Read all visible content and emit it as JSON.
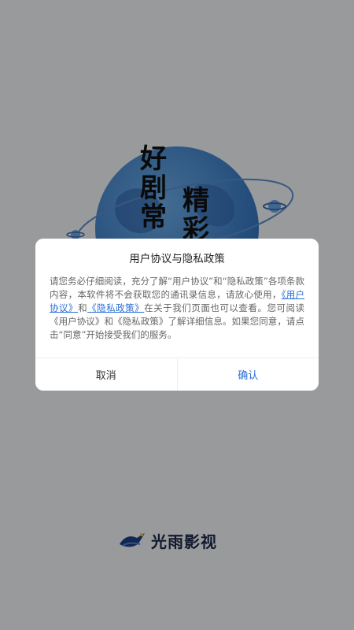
{
  "splash": {
    "slogan_left": [
      "好",
      "剧",
      "常"
    ],
    "slogan_right": [
      "精",
      "彩"
    ]
  },
  "brand": {
    "name": "光雨影视",
    "logo_icon": "bird-logo-icon"
  },
  "dialog": {
    "title": "用户协议与隐私政策",
    "body": {
      "part1": "请您务必仔细阅读，充分了解“用户协议”和“隐私政策”各项条款内容，本软件将不会获取您的通讯录信息，请放心使用，",
      "link_user_agreement": "《用户协议》",
      "and": "和",
      "link_privacy_policy": "《隐私政策》",
      "part2": "在关于我们页面也可以查看。您可阅读《用户协议》和《隐私政策》了解详细信息。如果您同意，请点击“同意”开始接受我们的服务。"
    },
    "cancel_label": "取消",
    "confirm_label": "确认"
  },
  "colors": {
    "accent": "#2b6fd6",
    "overlay": "#9e9e9e",
    "globe": "#3f82cf"
  }
}
